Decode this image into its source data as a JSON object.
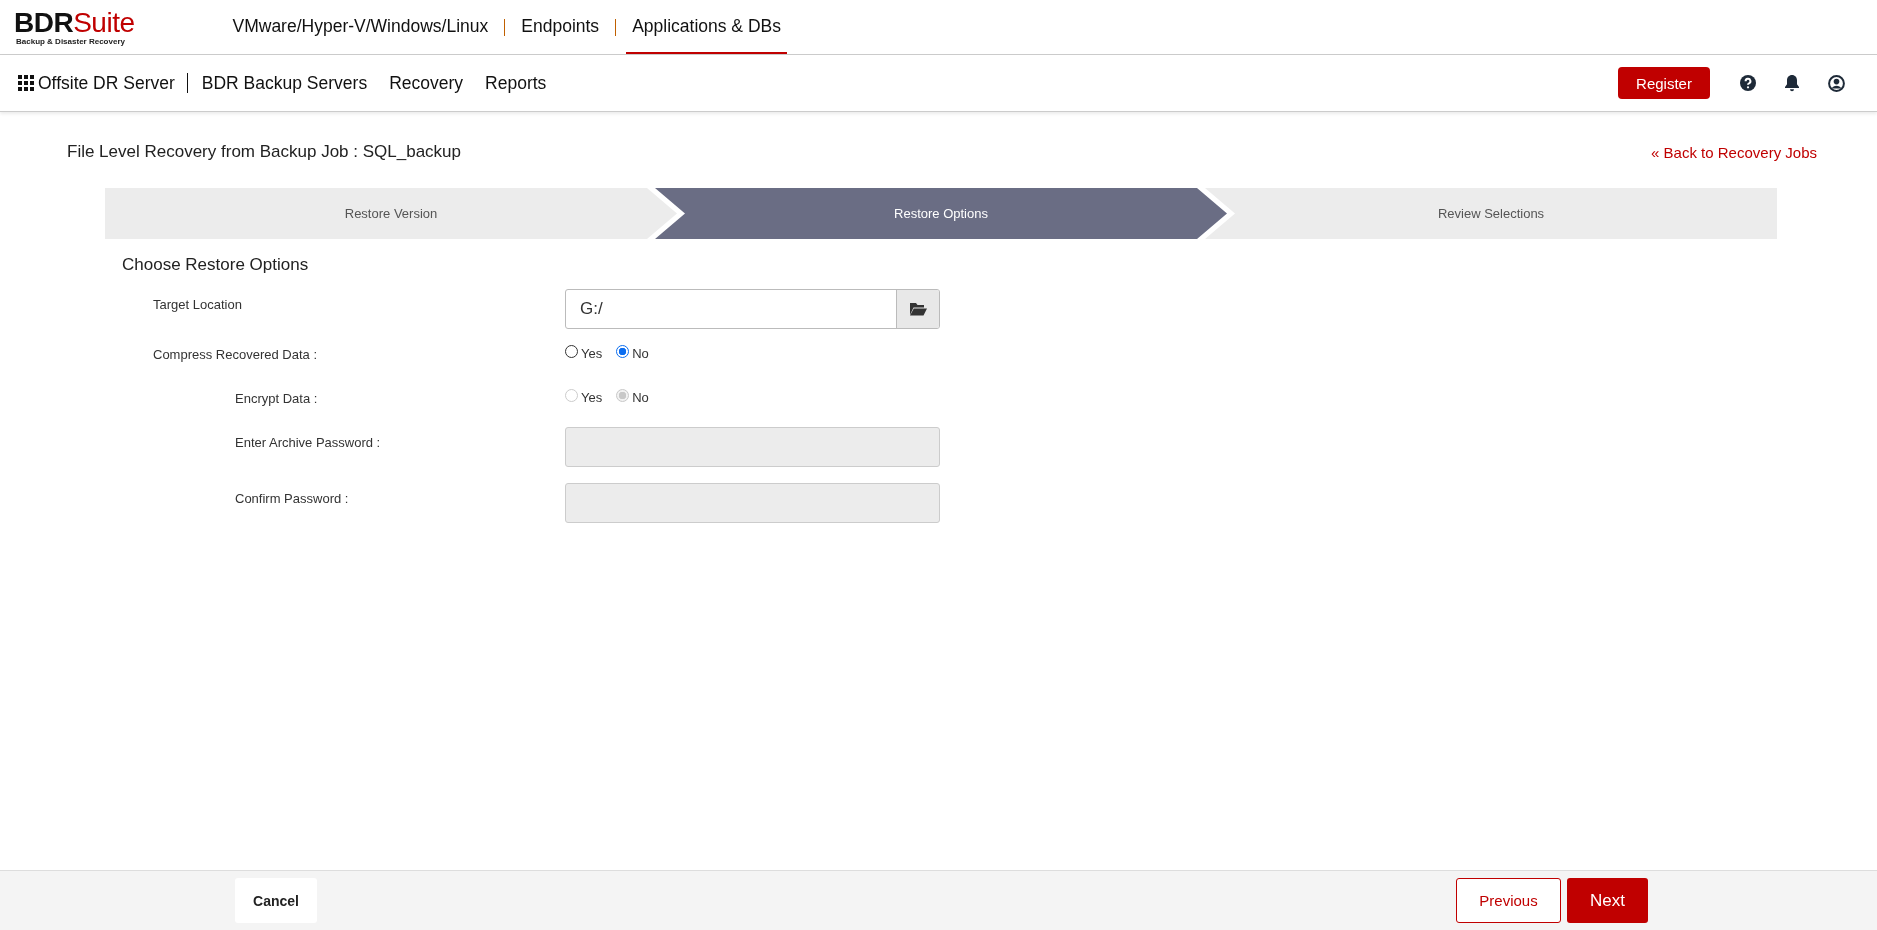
{
  "header": {
    "logo": {
      "brand": "BDR",
      "brand_accent": "Suite",
      "tagline": "Backup & Disaster Recovery"
    },
    "product_tabs": [
      {
        "label": "VMware/Hyper-V/Windows/Linux",
        "selected": false
      },
      {
        "label": "Endpoints",
        "selected": false
      },
      {
        "label": "Applications & DBs",
        "selected": true
      }
    ]
  },
  "nav": {
    "title": "Offsite DR Server",
    "items": [
      "BDR Backup Servers",
      "Recovery",
      "Reports"
    ],
    "register": "Register"
  },
  "page": {
    "title": "File Level Recovery from Backup Job : SQL_backup",
    "back_link": "« Back to Recovery Jobs"
  },
  "steps": [
    {
      "label": "Restore Version",
      "selected": false
    },
    {
      "label": "Restore Options",
      "selected": true
    },
    {
      "label": "Review Selections",
      "selected": false
    }
  ],
  "form": {
    "heading": "Choose Restore Options",
    "fields": [
      {
        "kind": "folder",
        "label": "Target Location",
        "value": "G:/"
      },
      {
        "kind": "radio",
        "label": "Compress Recovered Data :",
        "disabled": false,
        "options": [
          {
            "label": "Yes",
            "selected": false
          },
          {
            "label": "No",
            "selected": true
          }
        ],
        "children": [
          {
            "kind": "radio",
            "label": "Encrypt Data :",
            "disabled": true,
            "options": [
              {
                "label": "Yes",
                "selected": false
              },
              {
                "label": "No",
                "selected": true
              }
            ]
          },
          {
            "kind": "password",
            "label": "Enter Archive Password :",
            "disabled": true
          },
          {
            "kind": "password",
            "label": "Confirm Password :",
            "disabled": true
          }
        ]
      }
    ]
  },
  "footer": {
    "cancel": "Cancel",
    "previous": "Previous",
    "next": "Next"
  }
}
